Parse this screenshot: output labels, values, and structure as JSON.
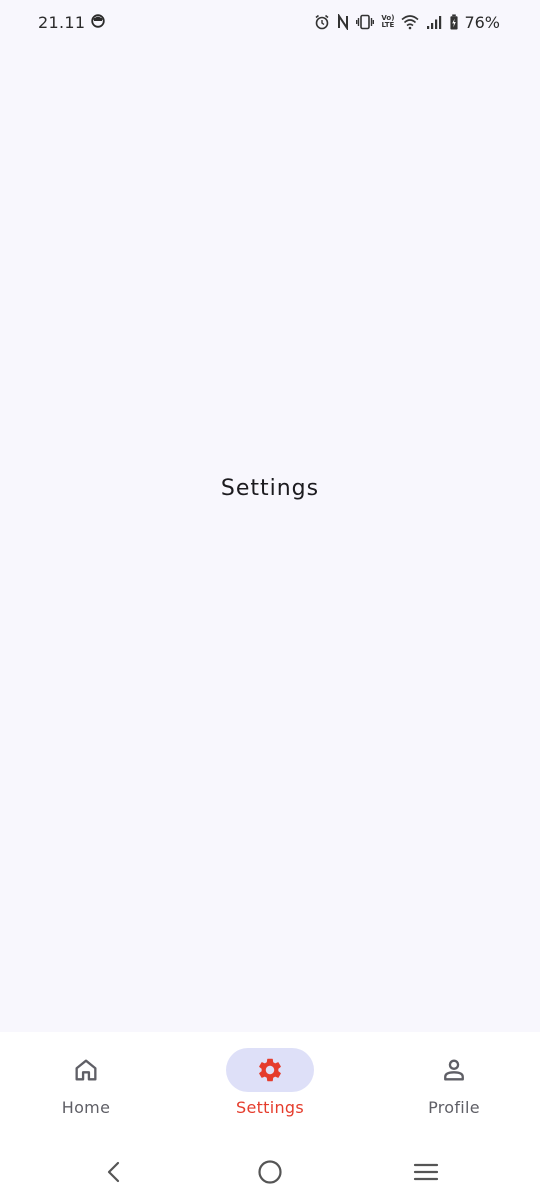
{
  "status_bar": {
    "time": "21.11",
    "battery_percent": "76%",
    "volte_top": "Vo)",
    "volte_bottom": "LTE",
    "icons": [
      "face-icon",
      "alarm-icon",
      "nfc-icon",
      "vibrate-icon",
      "volte-icon",
      "wifi-icon",
      "signal-icon",
      "battery-charging-icon"
    ]
  },
  "main": {
    "title": "Settings"
  },
  "bottom_nav": {
    "items": [
      {
        "label": "Home",
        "icon": "home-icon",
        "selected": false
      },
      {
        "label": "Settings",
        "icon": "gear-icon",
        "selected": true
      },
      {
        "label": "Profile",
        "icon": "person-icon",
        "selected": false
      }
    ]
  },
  "colors": {
    "background": "#f8f7fd",
    "accent": "#e53c2c",
    "indicator": "#dee0f8",
    "nav_bg": "#ffffff",
    "inactive": "#5f5f66"
  },
  "system_nav": {
    "buttons": [
      "back-icon",
      "home-circle-icon",
      "recents-icon"
    ]
  }
}
